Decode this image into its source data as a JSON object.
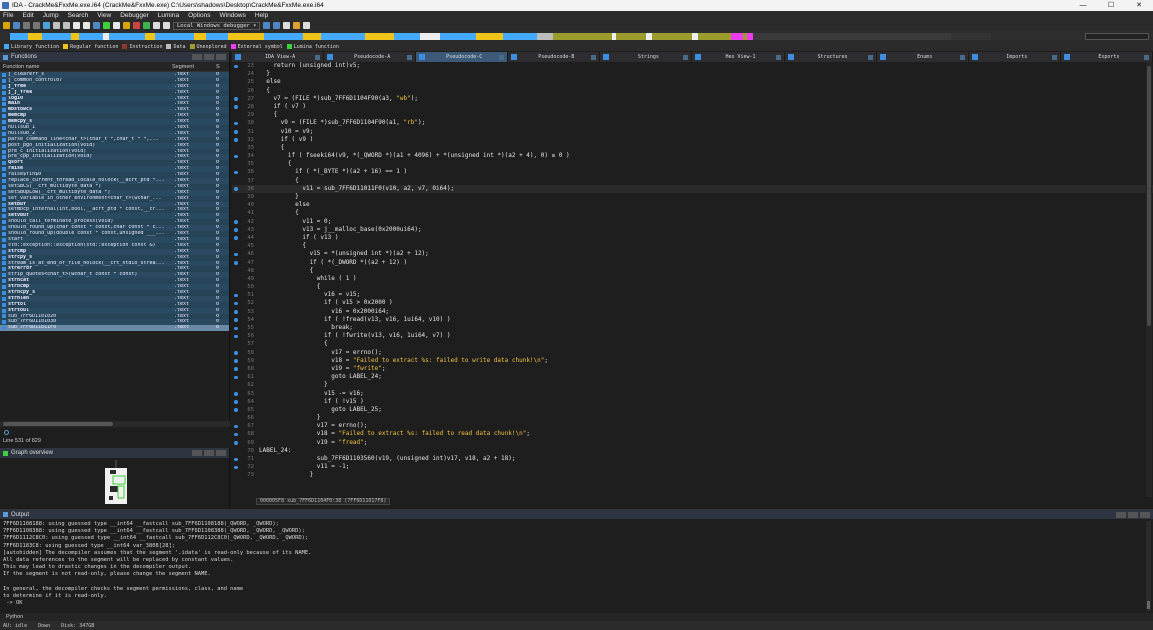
{
  "window": {
    "title": "IDA - CrackMe&FxxMe.exe.i64 (CrackMe&FxxMe.exe) C:\\Users\\shadows\\Desktop\\CrackMe&FxxMe.exe.i64",
    "controls": [
      "—",
      "☐",
      "✕"
    ]
  },
  "menu": [
    "File",
    "Edit",
    "Jump",
    "Search",
    "View",
    "Debugger",
    "Lumina",
    "Options",
    "Windows",
    "Help"
  ],
  "toolbar": {
    "debugger": "Local Windows debugger ▾"
  },
  "legend": [
    {
      "label": "Library function",
      "color": "#44aaff"
    },
    {
      "label": "Regular function",
      "color": "#f0c419"
    },
    {
      "label": "Instruction",
      "color": "#8b3a2b"
    },
    {
      "label": "Data",
      "color": "#bcbcbc"
    },
    {
      "label": "Unexplored",
      "color": "#9c9c2c"
    },
    {
      "label": "External symbol",
      "color": "#f03cf0"
    },
    {
      "label": "Lumina function",
      "color": "#3cd23c"
    }
  ],
  "functions": {
    "title": "Functions",
    "col_name": "Function name",
    "col_segment": "Segment",
    "col_s": "S",
    "rows": [
      {
        "name": "j_clearerr_s",
        "seg": ".text",
        "f": "0"
      },
      {
        "name": "j_common_control07",
        "seg": ".text",
        "f": "0"
      },
      {
        "name": "j_free",
        "seg": ".text",
        "f": "0"
      },
      {
        "name": "j_j_free",
        "seg": ".text",
        "f": "0"
      },
      {
        "name": "log10",
        "seg": ".text",
        "f": "0"
      },
      {
        "name": "main",
        "seg": ".text",
        "f": "0"
      },
      {
        "name": "mbstowcs",
        "seg": ".text",
        "f": "0"
      },
      {
        "name": "memcmp",
        "seg": ".text",
        "f": "0"
      },
      {
        "name": "memcpy_s",
        "seg": ".text",
        "f": "0"
      },
      {
        "name": "nullsub_1",
        "seg": ".text",
        "f": "0"
      },
      {
        "name": "nullsub_2",
        "seg": ".text",
        "f": "0"
      },
      {
        "name": "parse_command_line<char_t>(char_t *,char_t * *,...",
        "seg": ".text",
        "f": "0"
      },
      {
        "name": "post_pgo_initialization(void)",
        "seg": ".text",
        "f": "0"
      },
      {
        "name": "pre_c_initialization(void)",
        "seg": ".text",
        "f": "0"
      },
      {
        "name": "pre_cpp_initialization(void)",
        "seg": ".text",
        "f": "0"
      },
      {
        "name": "qsort",
        "seg": ".text",
        "f": "0"
      },
      {
        "name": "raise",
        "seg": ".text",
        "f": "0"
      },
      {
        "name": "raise$fin$0",
        "seg": ".text",
        "f": "0"
      },
      {
        "name": "replace_current_thread_locale_nolock(__acrt_ptd *...",
        "seg": ".text",
        "f": "0"
      },
      {
        "name": "setSBCS(__crt_multibyte_data *)",
        "seg": ".text",
        "f": "0"
      },
      {
        "name": "setSBUpLow(__crt_multibyte_data *)",
        "seg": ".text",
        "f": "0"
      },
      {
        "name": "set_variable_in_other_environment<char_t>(wchar_...",
        "seg": ".text",
        "f": "0"
      },
      {
        "name": "setbuf",
        "seg": ".text",
        "f": "0"
      },
      {
        "name": "setmbcp_internal(int,bool,__acrt_ptd * const,__cr...",
        "seg": ".text",
        "f": "0"
      },
      {
        "name": "setvbuf",
        "seg": ".text",
        "f": "0"
      },
      {
        "name": "should_call_terminate_process(void)",
        "seg": ".text",
        "f": "0"
      },
      {
        "name": "should_round_up(char const * const,char const * c...",
        "seg": ".text",
        "f": "0"
      },
      {
        "name": "should_round_up(double const * const,unsigned ___...",
        "seg": ".text",
        "f": "0"
      },
      {
        "name": "start",
        "seg": ".text",
        "f": "0"
      },
      {
        "name": "std::exception::exception(std::exception const &)",
        "seg": ".text",
        "f": "0"
      },
      {
        "name": "strcmp",
        "seg": ".text",
        "f": "0"
      },
      {
        "name": "strcpy_s",
        "seg": ".text",
        "f": "0"
      },
      {
        "name": "stream_is_at_end_of_file_nolock(__crt_stdio_strea...",
        "seg": ".text",
        "f": "0"
      },
      {
        "name": "strerror",
        "seg": ".text",
        "f": "0"
      },
      {
        "name": "strip_quotes<char_t>(wchar_t const * const)",
        "seg": ".text",
        "f": "0"
      },
      {
        "name": "strncat",
        "seg": ".text",
        "f": "0"
      },
      {
        "name": "strncmp",
        "seg": ".text",
        "f": "0"
      },
      {
        "name": "strncpy_s",
        "seg": ".text",
        "f": "0"
      },
      {
        "name": "strnlen",
        "seg": ".text",
        "f": "0"
      },
      {
        "name": "strtol",
        "seg": ".text",
        "f": "0"
      },
      {
        "name": "strtoul",
        "seg": ".text",
        "f": "0"
      },
      {
        "name": "sub_7FF6D1101020",
        "seg": ".text",
        "f": "0"
      },
      {
        "name": "sub_7FF6D1101030",
        "seg": ".text",
        "f": "0"
      },
      {
        "name": "sub_7FF6D11011F0",
        "seg": ".text",
        "f": "0"
      }
    ],
    "line_info": "Line 531 of 829"
  },
  "graph": {
    "title": "Graph overview"
  },
  "tabs": [
    {
      "label": "IDA View-A"
    },
    {
      "label": "Pseudocode-A"
    },
    {
      "label": "Pseudocode-C"
    },
    {
      "label": "Pseudocode-B"
    },
    {
      "label": "Strings"
    },
    {
      "label": "Hex View-1"
    },
    {
      "label": "Structures"
    },
    {
      "label": "Enums"
    },
    {
      "label": "Imports"
    },
    {
      "label": "Exports"
    }
  ],
  "code": [
    {
      "n": "23",
      "t": "    return (unsigned int)v5;",
      "bp": true
    },
    {
      "n": "24",
      "t": "  }",
      "bp": false
    },
    {
      "n": "25",
      "t": "  else",
      "bp": false
    },
    {
      "n": "26",
      "t": "  {",
      "bp": false
    },
    {
      "n": "27",
      "t": "    v7 = (FILE *)sub_7FF6D1104F90(a3, \"wb\");",
      "bp": true
    },
    {
      "n": "28",
      "t": "    if ( v7 )",
      "bp": true
    },
    {
      "n": "29",
      "t": "    {",
      "bp": false
    },
    {
      "n": "30",
      "t": "      v9 = (FILE *)sub_7FF6D1104F90(a1, \"rb\");",
      "bp": true
    },
    {
      "n": "31",
      "t": "      v10 = v9;",
      "bp": true
    },
    {
      "n": "32",
      "t": "      if ( v9 )",
      "bp": true
    },
    {
      "n": "33",
      "t": "      {",
      "bp": false
    },
    {
      "n": "34",
      "t": "        if ( fseeki64(v9, *(_QWORD *)(a1 + 4096) + *(unsigned int *)(a2 + 4), 0) ≥ 0 )",
      "bp": true
    },
    {
      "n": "35",
      "t": "        {",
      "bp": false
    },
    {
      "n": "36",
      "t": "          if ( *(_BYTE *)(a2 + 16) == 1 )",
      "bp": true
    },
    {
      "n": "37",
      "t": "          {",
      "bp": false
    },
    {
      "n": "38",
      "t": "            v11 = sub_7FF6D11011F0(v10, a2, v7, 0i64);",
      "bp": true,
      "hl": true
    },
    {
      "n": "39",
      "t": "          }",
      "bp": false
    },
    {
      "n": "40",
      "t": "          else",
      "bp": false
    },
    {
      "n": "41",
      "t": "          {",
      "bp": false
    },
    {
      "n": "42",
      "t": "            v11 = 0;",
      "bp": true
    },
    {
      "n": "43",
      "t": "            v13 = j__malloc_base(0x2000ui64);",
      "bp": true
    },
    {
      "n": "44",
      "t": "            if ( v13 )",
      "bp": true
    },
    {
      "n": "45",
      "t": "            {",
      "bp": false
    },
    {
      "n": "46",
      "t": "              v15 = *(unsigned int *)(a2 + 12);",
      "bp": true
    },
    {
      "n": "47",
      "t": "              if ( *(_DWORD *)(a2 + 12) )",
      "bp": true
    },
    {
      "n": "48",
      "t": "              {",
      "bp": false
    },
    {
      "n": "49",
      "t": "                while ( 1 )",
      "bp": false
    },
    {
      "n": "50",
      "t": "                {",
      "bp": false
    },
    {
      "n": "51",
      "t": "                  v16 = v15;",
      "bp": true
    },
    {
      "n": "52",
      "t": "                  if ( v15 > 0x2000 )",
      "bp": true
    },
    {
      "n": "53",
      "t": "                    v16 = 0x2000i64;",
      "bp": true
    },
    {
      "n": "54",
      "t": "                  if ( !fread(v13, v16, 1ui64, v10) )",
      "bp": true
    },
    {
      "n": "55",
      "t": "                    break;",
      "bp": true
    },
    {
      "n": "56",
      "t": "                  if ( !fwrite(v13, v16, 1ui64, v7) )",
      "bp": true
    },
    {
      "n": "57",
      "t": "                  {",
      "bp": false
    },
    {
      "n": "58",
      "t": "                    v17 = errno();",
      "bp": true
    },
    {
      "n": "59",
      "t": "                    v18 = \"Failed to extract %s: failed to write data chunk!\\n\";",
      "bp": true
    },
    {
      "n": "60",
      "t": "                    v19 = \"fwrite\";",
      "bp": true
    },
    {
      "n": "61",
      "t": "                    goto LABEL_24;",
      "bp": true
    },
    {
      "n": "62",
      "t": "                  }",
      "bp": false
    },
    {
      "n": "63",
      "t": "                  v15 -= v16;",
      "bp": true
    },
    {
      "n": "64",
      "t": "                  if ( !v15 )",
      "bp": true
    },
    {
      "n": "65",
      "t": "                    goto LABEL_25;",
      "bp": true
    },
    {
      "n": "66",
      "t": "                }",
      "bp": false
    },
    {
      "n": "67",
      "t": "                v17 = errno();",
      "bp": true
    },
    {
      "n": "68",
      "t": "                v18 = \"Failed to extract %s: failed to read data chunk!\\n\";",
      "bp": true
    },
    {
      "n": "69",
      "t": "                v19 = \"fread\";",
      "bp": true
    },
    {
      "n": "70",
      "t": "LABEL_24:",
      "bp": false
    },
    {
      "n": "71",
      "t": "                sub_7FF6D1103560(v19, (unsigned int)v17, v18, a2 + 18);",
      "bp": true
    },
    {
      "n": "72",
      "t": "                v11 = -1;",
      "bp": true
    },
    {
      "n": "73",
      "t": "              }",
      "bp": false
    }
  ],
  "code_status": "000005F8 sub_7FF6D1104F0:38 (7FF6D11017F8)",
  "output": {
    "title": "Output",
    "lines": [
      "7FF6D1108188: using guessed type __int64 __fastcall sub_7FF6D1108188(_QWORD, _QWORD);",
      "7FF6D1108388: using guessed type __int64 __fastcall sub_7FF6D1108388(_QWORD, _QWORD, _QWORD);",
      "7FF6D1112C8C0: using guessed type __int64 __fastcall sub_7FF6D112C8C0(_QWORD, _QWORD, _QWORD);",
      "7FF6D1183C8: using guessed type __int64 var_3808[28];",
      "[autohidden] The decompiler assumes that the segment '.idata' is read-only because of its NAME.",
      "All data references to the segment will be replaced by constant values.",
      "This may lead to drastic changes in the decompiler output.",
      "If the segment is not read-only, please change the segment NAME.",
      "",
      "In general, the decompiler checks the segment permissions, class, and name",
      "to determine if it is read-only.",
      " -> OK"
    ]
  },
  "python_label": "Python",
  "status": {
    "au": "AU:  idle",
    "dir": "Down",
    "disk": "Disk: 347GB"
  }
}
